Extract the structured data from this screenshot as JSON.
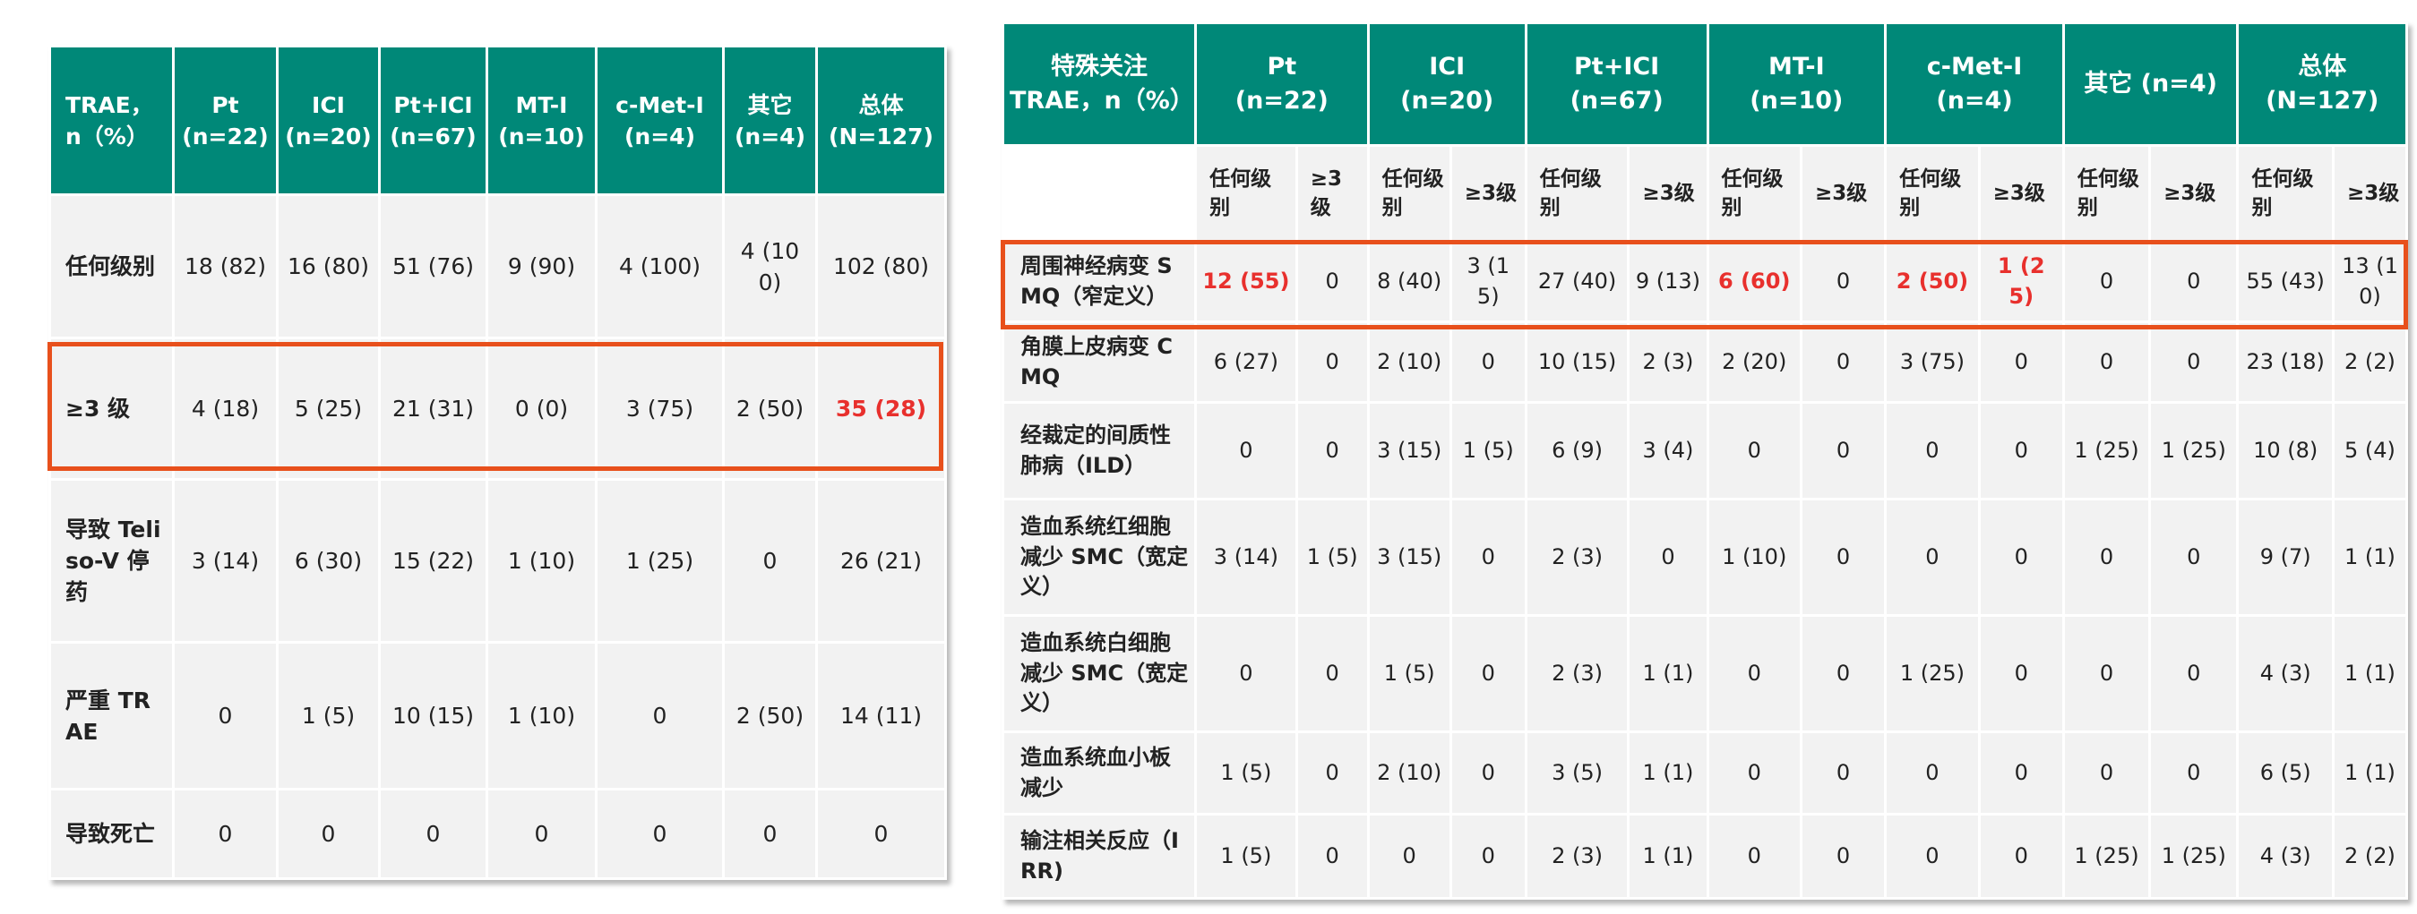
{
  "colors": {
    "header_bg": "#008878",
    "cell_bg": "#f2f2f2",
    "highlight_border": "#e8501c",
    "highlight_text": "#e8302d"
  },
  "table1": {
    "headers": [
      "TRAE，n（%）",
      "Pt\n(n=22)",
      "ICI\n(n=20)",
      "Pt+ICI\n(n=67)",
      "MT-I\n(n=10)",
      "c-Met-I\n(n=4)",
      "其它\n(n=4)",
      "总体\n(N=127)"
    ],
    "rows": [
      {
        "label": "任何级别",
        "cells": [
          "18 (82)",
          "16 (80)",
          "51 (76)",
          "9 (90)",
          "4 (100)",
          "4 (100)",
          "102 (80)"
        ]
      },
      {
        "label": "≥3 级",
        "cells": [
          "4 (18)",
          "5 (25)",
          "21 (31)",
          "0 (0)",
          "3 (75)",
          "2 (50)",
          "35 (28)"
        ]
      },
      {
        "label": "导致 Teliso-V 停药",
        "cells": [
          "3 (14)",
          "6 (30)",
          "15 (22)",
          "1 (10)",
          "1 (25)",
          "0",
          "26 (21)"
        ]
      },
      {
        "label": "严重 TRAE",
        "cells": [
          "0",
          "1 (5)",
          "10 (15)",
          "1 (10)",
          "0",
          "2 (50)",
          "14 (11)"
        ]
      },
      {
        "label": "导致死亡",
        "cells": [
          "0",
          "0",
          "0",
          "0",
          "0",
          "0",
          "0"
        ]
      }
    ]
  },
  "table2": {
    "headers": [
      "特殊关注\nTRAE，n（%）",
      "Pt\n(n=22)",
      "ICI\n(n=20)",
      "Pt+ICI\n(n=67)",
      "MT-I\n(n=10)",
      "c-Met-I\n(n=4)",
      "其它 (n=4)",
      "总体\n(N=127)"
    ],
    "sub_any": "任何级别",
    "sub_g3": "≥3级",
    "rows": [
      {
        "label": "周围神经病变 SMQ（窄定义）",
        "cells": [
          "12 (55)",
          "0",
          "8 (40)",
          "3 (15)",
          "27 (40)",
          "9 (13)",
          "6 (60)",
          "0",
          "2 (50)",
          "1 (25)",
          "0",
          "0",
          "55 (43)",
          "13 (10)"
        ]
      },
      {
        "label": "角膜上皮病变 CMQ",
        "cells": [
          "6 (27)",
          "0",
          "2 (10)",
          "0",
          "10 (15)",
          "2 (3)",
          "2 (20)",
          "0",
          "3 (75)",
          "0",
          "0",
          "0",
          "23 (18)",
          "2 (2)"
        ]
      },
      {
        "label": "经裁定的间质性肺病（ILD）",
        "cells": [
          "0",
          "0",
          "3 (15)",
          "1 (5)",
          "6 (9)",
          "3 (4)",
          "0",
          "0",
          "0",
          "0",
          "1 (25)",
          "1 (25)",
          "10 (8)",
          "5 (4)"
        ]
      },
      {
        "label": "造血系统红细胞减少 SMC（宽定义）",
        "cells": [
          "3 (14)",
          "1 (5)",
          "3 (15)",
          "0",
          "2 (3)",
          "0",
          "1 (10)",
          "0",
          "0",
          "0",
          "0",
          "0",
          "9 (7)",
          "1 (1)"
        ]
      },
      {
        "label": "造血系统白细胞减少 SMC（宽定义）",
        "cells": [
          "0",
          "0",
          "1 (5)",
          "0",
          "2 (3)",
          "1 (1)",
          "0",
          "0",
          "1 (25)",
          "0",
          "0",
          "0",
          "4 (3)",
          "1 (1)"
        ]
      },
      {
        "label": "造血系统血小板减少",
        "cells": [
          "1 (5)",
          "0",
          "2 (10)",
          "0",
          "3 (5)",
          "1 (1)",
          "0",
          "0",
          "0",
          "0",
          "0",
          "0",
          "6 (5)",
          "1 (1)"
        ]
      },
      {
        "label": "输注相关反应（IRR)",
        "cells": [
          "1 (5)",
          "0",
          "0",
          "0",
          "2 (3)",
          "1 (1)",
          "0",
          "0",
          "0",
          "0",
          "1 (25)",
          "1 (25)",
          "4 (3)",
          "2 (2)"
        ]
      }
    ]
  }
}
